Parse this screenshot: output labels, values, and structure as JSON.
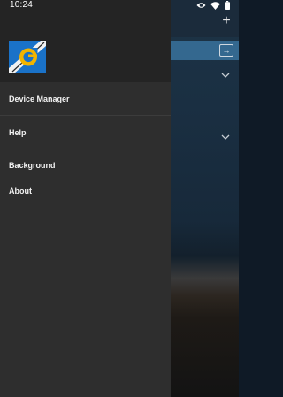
{
  "status_bar": {
    "time": "10:24",
    "icons": [
      "eye-icon",
      "wifi-icon",
      "battery-icon"
    ]
  },
  "drawer": {
    "logo_icon": "gopro-logo-icon",
    "menu_items": [
      {
        "label": "Device Manager"
      },
      {
        "label": "Help"
      },
      {
        "label": "Background"
      },
      {
        "label": "About"
      }
    ]
  },
  "background_app": {
    "icons": [
      "plus-icon",
      "square-arrow-icon",
      "chevron-down-icon",
      "chevron-down-icon"
    ],
    "colors": {
      "accent_row": "#34688f",
      "drawer": "#2e2e2e",
      "drawer_header": "#242424",
      "logo_blue": "#1a72c8",
      "logo_yellow": "#f2b400"
    }
  }
}
